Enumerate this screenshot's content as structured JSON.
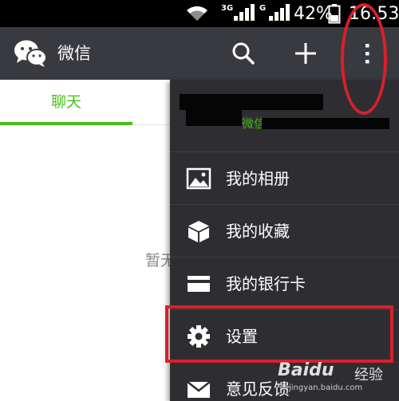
{
  "status_bar": {
    "network_3g": "3G",
    "network_g": "G",
    "battery_percent": "42%",
    "time": "16:53",
    "icons": [
      "wifi-icon",
      "signal-icon",
      "battery-icon"
    ]
  },
  "app_bar": {
    "title": "微信",
    "icons": [
      "wechat-logo",
      "search-icon",
      "plus-icon",
      "more-vertical-icon"
    ],
    "color": "#393a3f"
  },
  "tabs": [
    {
      "label": "聊天",
      "active": true,
      "color": "#45c01a"
    }
  ],
  "main": {
    "empty_text": "暂无"
  },
  "menu": {
    "profile": {
      "wechat_id_label": "微信号："
    },
    "items": [
      {
        "label": "我的相册",
        "icon": "album-icon"
      },
      {
        "label": "我的收藏",
        "icon": "favorites-icon"
      },
      {
        "label": "我的银行卡",
        "icon": "bank-card-icon"
      },
      {
        "label": "设置",
        "icon": "settings-gear-icon"
      },
      {
        "label": "意见反馈",
        "icon": "feedback-mail-icon"
      }
    ],
    "background": "#2e2e32"
  },
  "annotations": {
    "color": "#d9202a"
  },
  "watermark": {
    "logo": "Baidu",
    "text": "经验",
    "url": "jingyan.baidu.com"
  }
}
